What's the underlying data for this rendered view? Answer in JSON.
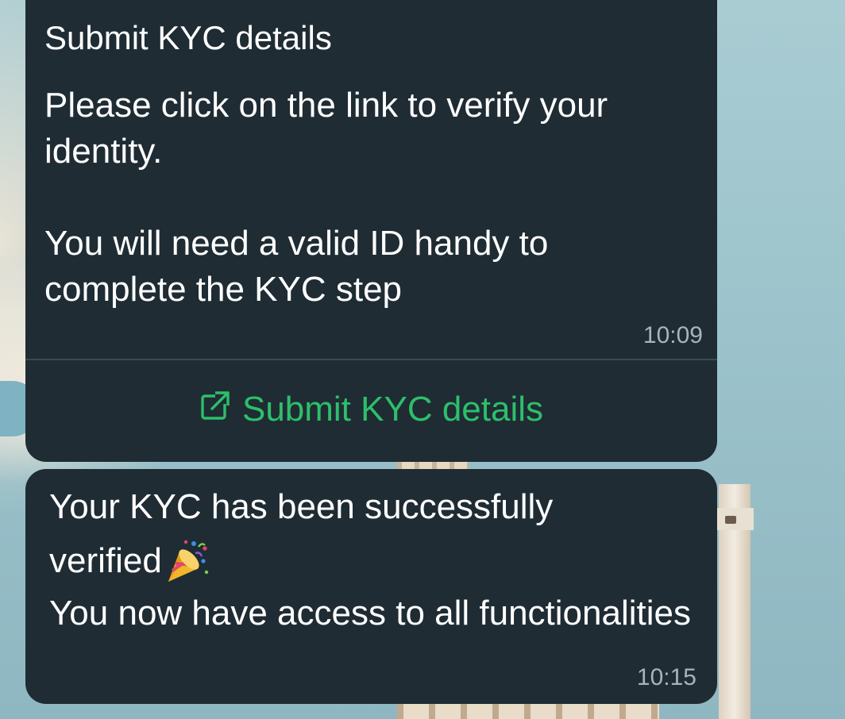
{
  "messages": {
    "kyc_request": {
      "title": "Submit KYC details",
      "body_line1": "Please click on the link to verify your identity.",
      "body_line2": "You will need a valid ID handy to complete the KYC step",
      "time": "10:09",
      "action_label": "Submit KYC details",
      "action_icon": "external-link-icon"
    },
    "kyc_success": {
      "line1": "Your KYC has been successfully",
      "line2": "verified",
      "emoji": "party-popper-icon",
      "line3": "You now have access to all functionalities",
      "time": "10:15"
    }
  },
  "colors": {
    "bubble_bg": "#1f2c34",
    "link_green": "#2dbf6a",
    "timestamp": "#a9b3b8"
  }
}
